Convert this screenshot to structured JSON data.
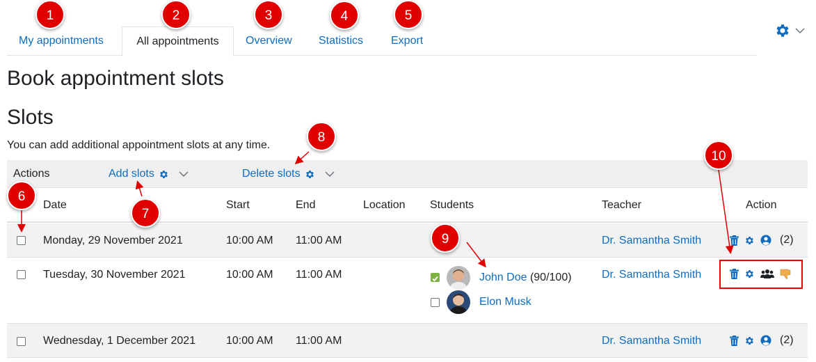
{
  "tabs": [
    {
      "label": "My appointments",
      "active": false
    },
    {
      "label": "All appointments",
      "active": true
    },
    {
      "label": "Overview",
      "active": false
    },
    {
      "label": "Statistics",
      "active": false
    },
    {
      "label": "Export",
      "active": false
    }
  ],
  "page_title": "Book appointment slots",
  "section_title": "Slots",
  "intro_text": "You can add additional appointment slots at any time.",
  "actions": {
    "label": "Actions",
    "add_slots": "Add slots",
    "delete_slots": "Delete slots"
  },
  "table": {
    "headers": {
      "date": "Date",
      "start": "Start",
      "end": "End",
      "location": "Location",
      "students": "Students",
      "teacher": "Teacher",
      "action": "Action"
    },
    "rows": [
      {
        "date": "Monday, 29 November 2021",
        "start": "10:00 AM",
        "end": "11:00 AM",
        "location": "",
        "students": [],
        "teacher": "Dr. Samantha Smith",
        "count": "(2)"
      },
      {
        "date": "Tuesday, 30 November 2021",
        "start": "10:00 AM",
        "end": "11:00 AM",
        "location": "",
        "students": [
          {
            "name": "John Doe",
            "grade": "(90/100)",
            "checked": true
          },
          {
            "name": "Elon Musk",
            "grade": "",
            "checked": false
          }
        ],
        "teacher": "Dr. Samantha Smith",
        "count": ""
      },
      {
        "date": "Wednesday, 1 December 2021",
        "start": "10:00 AM",
        "end": "11:00 AM",
        "location": "",
        "students": [],
        "teacher": "Dr. Samantha Smith",
        "count": "(2)"
      }
    ]
  },
  "annotations": [
    "1",
    "2",
    "3",
    "4",
    "5",
    "6",
    "7",
    "8",
    "9",
    "10"
  ],
  "colors": {
    "link": "#0f6cbf",
    "annotation": "#e00000",
    "check_green": "#7cb342",
    "thumb_orange": "#f0ad4e"
  },
  "icons": {
    "settings": "gear-icon",
    "dropdown": "chevron-down-icon",
    "delete": "trash-icon",
    "edit": "gear-icon",
    "single_user": "user-circle-icon",
    "group": "users-icon",
    "no_show": "thumbs-down-icon"
  }
}
